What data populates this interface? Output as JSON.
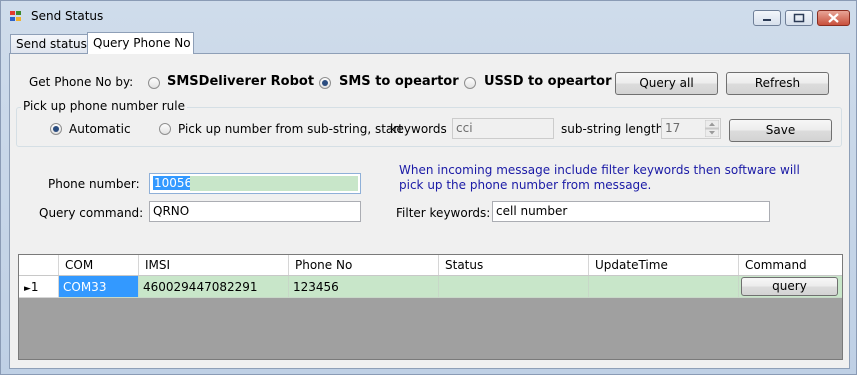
{
  "window": {
    "title": "Send Status",
    "controls": [
      "minimize-icon",
      "maximize-icon",
      "close-icon"
    ]
  },
  "tabs": [
    {
      "label": "Send status",
      "active": false
    },
    {
      "label": "Query Phone No",
      "active": true
    }
  ],
  "get_phone": {
    "label": "Get Phone No by:",
    "options": [
      {
        "label": "SMSDeliverer Robot",
        "selected": false
      },
      {
        "label": "SMS to opeartor",
        "selected": true
      },
      {
        "label": "USSD to opeartor",
        "selected": false
      }
    ],
    "query_all_label": "Query all",
    "refresh_label": "Refresh"
  },
  "pickup_rule": {
    "group_label": "Pick up phone number rule",
    "automatic_label": "Automatic",
    "automatic_selected": true,
    "substring_label": "Pick up number from sub-string, start",
    "keywords_label": "keywords",
    "keywords_value": "cci",
    "sublength_label": "sub-string length",
    "sublength_value": "17",
    "save_label": "Save"
  },
  "form": {
    "phone_label": "Phone number:",
    "phone_value": "10056",
    "query_cmd_label": "Query command:",
    "query_cmd_value": "QRNO",
    "info_text": "When incoming message include filter keywords then software will pick up the phone number from message.",
    "filter_label": "Filter keywords:",
    "filter_value": "cell number"
  },
  "grid": {
    "columns": [
      "COM",
      "IMSI",
      "Phone No",
      "Status",
      "UpdateTime",
      "Command"
    ],
    "rows": [
      {
        "index": "1",
        "com": "COM33",
        "imsi": "460029447082291",
        "phone": "123456",
        "status": "",
        "update_time": "",
        "command": "query"
      }
    ]
  },
  "colors": {
    "row_green": "#c8e6c9",
    "selection_blue": "#3399ff",
    "info_text_blue": "#1a1aa6",
    "phone_field_green": "#c8e6c9"
  }
}
